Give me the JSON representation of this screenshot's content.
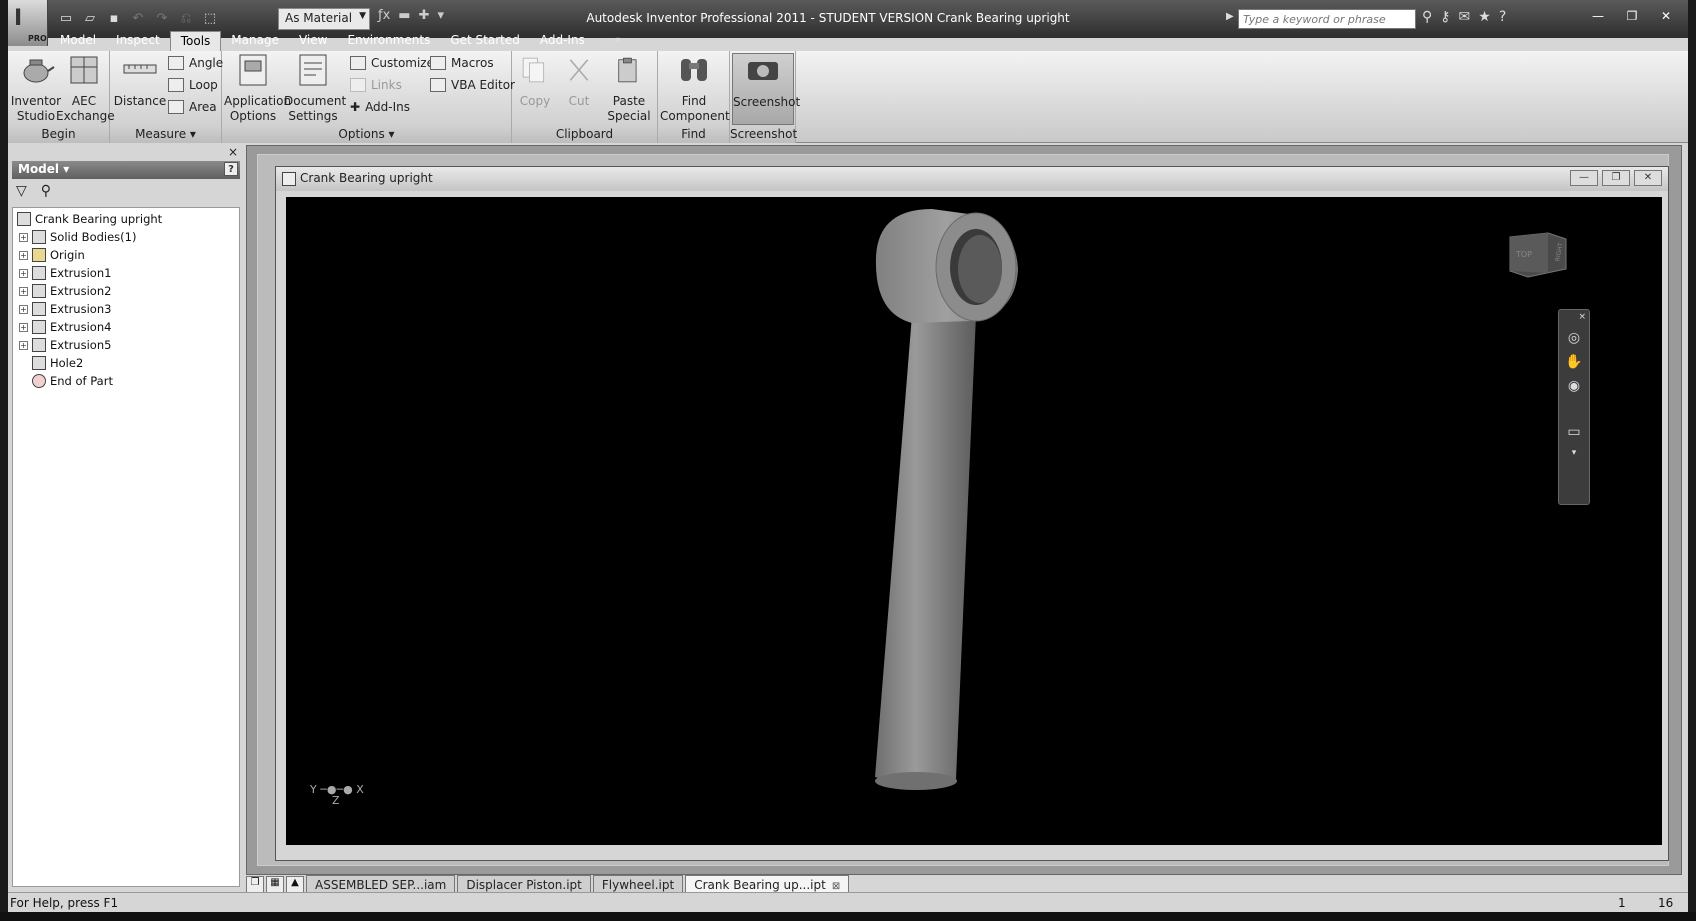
{
  "window": {
    "title": "Autodesk Inventor Professional 2011 - STUDENT VERSION   Crank Bearing upright",
    "app_badge": "PRO",
    "material": "As Material",
    "search_placeholder": "Type a keyword or phrase"
  },
  "tabs": [
    "Model",
    "Inspect",
    "Tools",
    "Manage",
    "View",
    "Environments",
    "Get Started",
    "Add-Ins"
  ],
  "active_tab": "Tools",
  "ribbon": {
    "begin": {
      "label": "Begin",
      "inventor_studio": "Inventor\nStudio",
      "aec_exchange": "AEC\nExchange"
    },
    "measure": {
      "label": "Measure ▾",
      "distance": "Distance",
      "angle": "Angle",
      "loop": "Loop",
      "area": "Area"
    },
    "options": {
      "label": "Options ▾",
      "application_options": "Application\nOptions",
      "document_settings": "Document\nSettings",
      "customize": "Customize",
      "links": "Links",
      "add_ins": "Add-Ins",
      "macros": "Macros",
      "vba_editor": "VBA Editor"
    },
    "clipboard": {
      "label": "Clipboard",
      "copy": "Copy",
      "cut": "Cut",
      "paste_special": "Paste\nSpecial"
    },
    "find": {
      "label": "Find",
      "find_component": "Find\nComponent"
    },
    "screenshot": {
      "label": "Screenshot",
      "screenshot": "Screenshot"
    }
  },
  "browser": {
    "title": "Model ▾",
    "help": "?",
    "close": "×",
    "root": "Crank Bearing upright",
    "items": [
      {
        "label": "Solid Bodies(1)",
        "expandable": true
      },
      {
        "label": "Origin",
        "expandable": true
      },
      {
        "label": "Extrusion1",
        "expandable": true
      },
      {
        "label": "Extrusion2",
        "expandable": true
      },
      {
        "label": "Extrusion3",
        "expandable": true
      },
      {
        "label": "Extrusion4",
        "expandable": true
      },
      {
        "label": "Extrusion5",
        "expandable": true
      },
      {
        "label": "Hole2",
        "expandable": false
      },
      {
        "label": "End of Part",
        "expandable": false
      }
    ]
  },
  "document": {
    "title": "Crank Bearing upright",
    "viewcube_top": "TOP",
    "viewcube_right": "RIGHT",
    "triad_y": "Y",
    "triad_x": "X",
    "triad_z": "Z"
  },
  "doc_tabs": [
    {
      "label": "ASSEMBLED SEP...iam",
      "active": false
    },
    {
      "label": "Displacer Piston.ipt",
      "active": false
    },
    {
      "label": "Flywheel.ipt",
      "active": false
    },
    {
      "label": "Crank Bearing up...ipt",
      "active": true
    }
  ],
  "status": {
    "help": "For Help, press F1",
    "count1": "1",
    "count2": "16"
  },
  "colors": {
    "title_bar": "#3a3a3a",
    "viewport": "#000000",
    "part": "#8c8c8c"
  }
}
